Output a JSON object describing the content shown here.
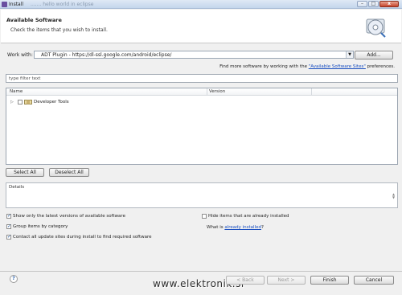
{
  "window": {
    "title": "Install",
    "ghost_title": "....... hello world in eclipse"
  },
  "header": {
    "title": "Available Software",
    "description": "Check the items that you wish to install."
  },
  "work_with": {
    "label": "Work with:",
    "value": "ADT Plugin - https://dl-ssl.google.com/android/eclipse/",
    "add_label": "Add..."
  },
  "hint": {
    "prefix": "Find more software by working with the ",
    "link": "\"Available Software Sites\"",
    "suffix": " preferences."
  },
  "filter": {
    "placeholder": "type filter text"
  },
  "table": {
    "columns": [
      "Name",
      "Version"
    ],
    "rows": [
      {
        "name": "Developer Tools",
        "expanded": false,
        "checked": false
      }
    ]
  },
  "selection": {
    "select_all": "Select All",
    "deselect_all": "Deselect All"
  },
  "details": {
    "label": "Details"
  },
  "options": {
    "latest_only": {
      "label": "Show only the latest versions of available software",
      "checked": true
    },
    "group_by_category": {
      "label": "Group items by category",
      "checked": true
    },
    "contact_sites": {
      "label": "Contact all update sites during install to find required software",
      "checked": true
    },
    "hide_installed": {
      "label": "Hide items that are already installed",
      "checked": false
    },
    "what_is_prefix": "What is ",
    "what_is_link": "already installed",
    "what_is_suffix": "?"
  },
  "footer": {
    "back": "< Back",
    "next": "Next >",
    "finish": "Finish",
    "cancel": "Cancel"
  },
  "watermark": "www.elektronik.si",
  "icons": {
    "help": "help-icon",
    "install": "install-disc-icon"
  }
}
